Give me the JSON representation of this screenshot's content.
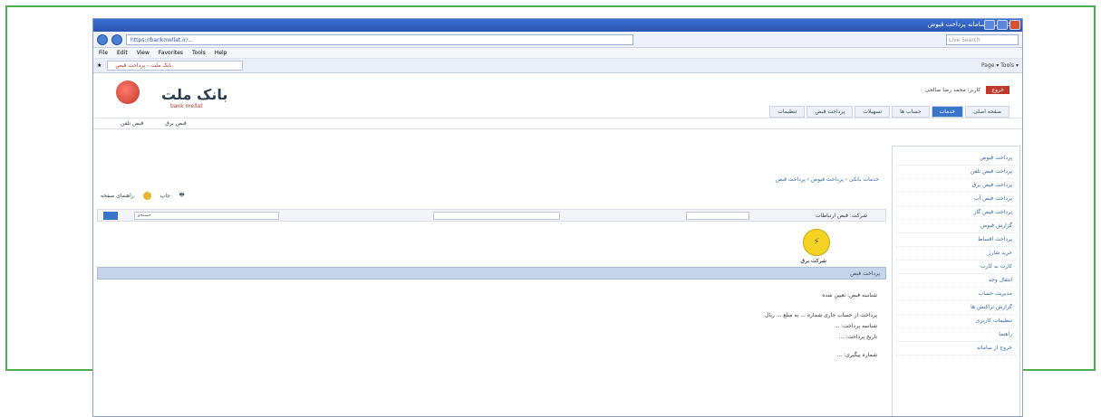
{
  "browser": {
    "title": "بانک ملت - سامانه پرداخت قبوض",
    "menu": [
      "File",
      "Edit",
      "View",
      "Favorites",
      "Tools",
      "Help"
    ],
    "address": "https://bankmellat.ir/...",
    "search_placeholder": "Live Search",
    "tab_label": "بانک ملت - پرداخت قبض",
    "tools_label": "Page ▾  Tools ▾"
  },
  "site": {
    "brand": "بانک ملت",
    "brand_sub": "bank mellat",
    "user_line": "کاربر: محمد رضا صالحی",
    "exit_label": "خروج",
    "nav": [
      "صفحه اصلی",
      "خدمات",
      "حساب ها",
      "تسهیلات",
      "پرداخت قبض",
      "تنظیمات"
    ],
    "subnav": [
      "قبض تلفن",
      "قبض برق"
    ],
    "breadcrumb": "خدمات بانکی › پرداخت قبوض › پرداخت قبض",
    "tool_print": "چاپ",
    "tool_help": "راهنمای صفحه",
    "filter_label": "شرکت: قبض ارتباطات",
    "filter_search": "جستجو",
    "biller_name": "شرکت برق",
    "band_label": "پرداخت قبض",
    "detail1": "شناسه قبض: تعیین شده",
    "detail2": "پرداخت از حساب جاری شماره ... به مبلغ ... ریال",
    "detail3": "شناسه پرداخت: ...",
    "detail4": "تاریخ پرداخت: ...",
    "detail5": "شماره پیگیری: ..."
  },
  "sidebar": {
    "items": [
      "پرداخت قبوض",
      "پرداخت قبض تلفن",
      "پرداخت قبض برق",
      "پرداخت قبض آب",
      "پرداخت قبض گاز",
      "گزارش قبوض",
      "پرداخت اقساط",
      "خرید شارژ",
      "کارت به کارت",
      "انتقال وجه",
      "مدیریت حساب",
      "گزارش تراکنش ها",
      "تنظیمات کاربری",
      "راهنما",
      "خروج از سامانه"
    ]
  }
}
